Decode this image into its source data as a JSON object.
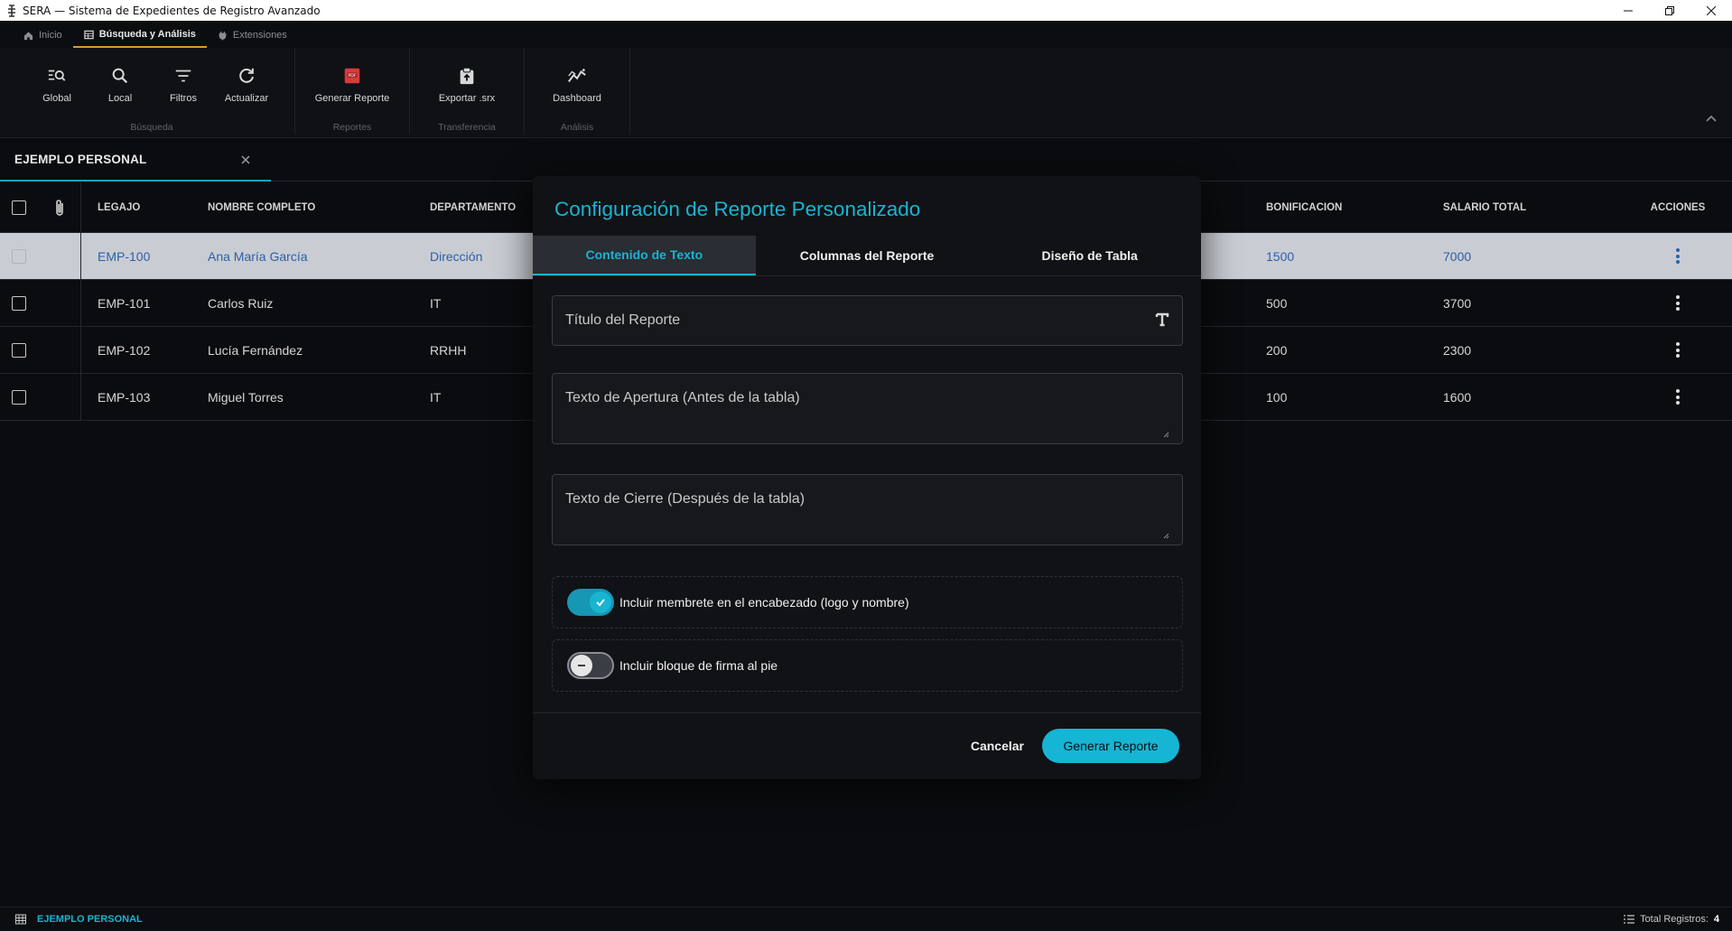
{
  "window": {
    "title": "SERA — Sistema de Expedientes de Registro Avanzado"
  },
  "ribbon_tabs": [
    {
      "label": "Inicio",
      "icon": "home-icon",
      "active": false
    },
    {
      "label": "Búsqueda y Análisis",
      "icon": "table-icon",
      "active": true
    },
    {
      "label": "Extensiones",
      "icon": "plugin-icon",
      "active": false
    }
  ],
  "ribbon": {
    "busqueda": {
      "label": "Búsqueda",
      "buttons": {
        "global": "Global",
        "local": "Local",
        "filtros": "Filtros",
        "actualizar": "Actualizar"
      }
    },
    "reportes": {
      "label": "Reportes",
      "buttons": {
        "generar": "Generar Reporte"
      }
    },
    "transferencia": {
      "label": "Transferencia",
      "buttons": {
        "exportar": "Exportar .srx"
      }
    },
    "analisis": {
      "label": "Análisis",
      "buttons": {
        "dashboard": "Dashboard"
      }
    }
  },
  "doc_tab": {
    "label": "EJEMPLO PERSONAL"
  },
  "table": {
    "headers": {
      "legajo": "LEGAJO",
      "nombre": "NOMBRE COMPLETO",
      "departamento": "DEPARTAMENTO",
      "bonificacion": "BONIFICACION",
      "salario": "SALARIO TOTAL",
      "acciones": "ACCIONES"
    },
    "rows": [
      {
        "legajo": "EMP-100",
        "nombre": "Ana María García",
        "departamento": "Dirección",
        "bonificacion": "1500",
        "salario": "7000",
        "selected": true
      },
      {
        "legajo": "EMP-101",
        "nombre": "Carlos Ruiz",
        "departamento": "IT",
        "bonificacion": "500",
        "salario": "3700",
        "selected": false
      },
      {
        "legajo": "EMP-102",
        "nombre": "Lucía Fernández",
        "departamento": "RRHH",
        "bonificacion": "200",
        "salario": "2300",
        "selected": false
      },
      {
        "legajo": "EMP-103",
        "nombre": "Miguel Torres",
        "departamento": "IT",
        "bonificacion": "100",
        "salario": "1600",
        "selected": false
      }
    ]
  },
  "modal": {
    "title": "Configuración de Reporte Personalizado",
    "tabs": [
      "Contenido de Texto",
      "Columnas del Reporte",
      "Diseño de Tabla"
    ],
    "active_tab": 0,
    "fields": {
      "titulo": "Título del Reporte",
      "apertura": "Texto de Apertura (Antes de la tabla)",
      "cierre": "Texto de Cierre (Después de la tabla)"
    },
    "switches": {
      "membrete": {
        "label": "Incluir membrete en el encabezado (logo y nombre)",
        "on": true
      },
      "firma": {
        "label": "Incluir bloque de firma al pie",
        "on": false
      }
    },
    "buttons": {
      "cancel": "Cancelar",
      "generate": "Generar Reporte"
    }
  },
  "statusbar": {
    "name": "EJEMPLO PERSONAL",
    "total_label": "Total Registros:",
    "total_value": "4"
  },
  "colors": {
    "accent": "#19b4d2",
    "tab_underline": "#d89b2a",
    "pdf_icon": "#d93a3a",
    "selected_row": "#c9cdd3"
  }
}
